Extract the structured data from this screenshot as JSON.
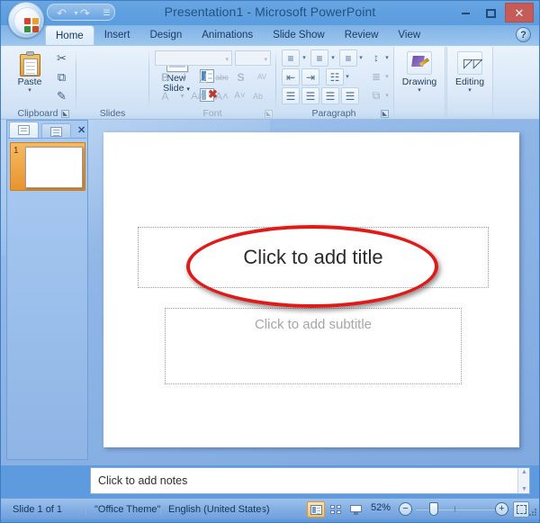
{
  "window": {
    "title": "Presentation1  -  Microsoft PowerPoint",
    "minimize_label": "",
    "maximize_label": "",
    "close_label": "✕"
  },
  "quick_access": {
    "undo_icon": "undo-icon",
    "undo_glyph": "↶",
    "undo_dropdown_glyph": "▾",
    "redo_icon": "redo-icon",
    "redo_glyph": "↷",
    "customize_glyph": "☰"
  },
  "office_button": {
    "label": "Office Button"
  },
  "help": {
    "glyph": "?"
  },
  "tabs": [
    {
      "label": "Home",
      "active": true
    },
    {
      "label": "Insert",
      "active": false
    },
    {
      "label": "Design",
      "active": false
    },
    {
      "label": "Animations",
      "active": false
    },
    {
      "label": "Slide Show",
      "active": false
    },
    {
      "label": "Review",
      "active": false
    },
    {
      "label": "View",
      "active": false
    }
  ],
  "ribbon": {
    "groups": [
      {
        "name": "Clipboard",
        "label": "Clipboard",
        "has_launcher": true,
        "disabled": false
      },
      {
        "name": "Slides",
        "label": "Slides",
        "has_launcher": false,
        "disabled": false
      },
      {
        "name": "Font",
        "label": "Font",
        "has_launcher": true,
        "disabled": true
      },
      {
        "name": "Paragraph",
        "label": "Paragraph",
        "has_launcher": true,
        "disabled": false
      }
    ],
    "clipboard": {
      "paste_label": "Paste",
      "paste_arrow": "▾",
      "cut_glyph": "✂",
      "copy_glyph": "⧉",
      "format_painter_glyph": "✎"
    },
    "slides": {
      "new_slide_line1": "New",
      "new_slide_line2": "Slide",
      "new_slide_arrow": "▾",
      "layout_arrow": "▾",
      "reset_arrow": "▾",
      "delete_glyph": "✖"
    },
    "font": {
      "font_name_value": "",
      "font_size_value": "",
      "bold": "B",
      "italic": "I",
      "underline": "U",
      "strikethrough": "abc",
      "shadow": "S",
      "spacing": "AV",
      "font_color": "A",
      "change_case": "Aa",
      "grow_font": "A˄",
      "shrink_font": "A˅",
      "clear_formatting": "Ab"
    },
    "paragraph": {
      "bullets": "≡",
      "numbering": "≡",
      "line_spacing": "≡",
      "text_direction": "↕",
      "decrease_indent": "⇤",
      "increase_indent": "⇥",
      "columns": "☷",
      "align_text": "≣",
      "align_left": "☰",
      "center": "☰",
      "align_right": "☰",
      "justify": "☰",
      "smartart": "⧉"
    },
    "drawing": {
      "label": "Drawing",
      "arrow": "▾"
    },
    "editing": {
      "label": "Editing",
      "arrow": "▾"
    }
  },
  "slide_pane": {
    "tab_slides_icon": "slides-tab-icon",
    "tab_outline_icon": "outline-tab-icon",
    "close_glyph": "✕",
    "thumbnails": [
      {
        "number": "1"
      }
    ]
  },
  "slide": {
    "title_placeholder": "Click to add title",
    "subtitle_placeholder": "Click to add subtitle",
    "annotation": {
      "shape": "ellipse",
      "color": "#e01b17"
    }
  },
  "notes": {
    "placeholder": "Click to add notes",
    "scroll_up_glyph": "▲",
    "scroll_down_glyph": "▼"
  },
  "status_bar": {
    "slide_count": "Slide 1 of 1",
    "theme": "\"Office Theme\"",
    "language": "English (United States)",
    "views": [
      {
        "name": "normal",
        "label": "Normal",
        "selected": true
      },
      {
        "name": "slide-sorter",
        "label": "Slide Sorter",
        "selected": false
      },
      {
        "name": "slide-show",
        "label": "Slide Show",
        "selected": false
      }
    ],
    "zoom_percent": "52%",
    "zoom_out_glyph": "−",
    "zoom_in_glyph": "+",
    "fit_label": "Fit slide to current window"
  },
  "colors": {
    "accent_blue": "#5b9cdf",
    "ribbon_bg": "#dfebf9",
    "annotation_red": "#e01b17",
    "thumb_orange": "#e8942f",
    "close_red": "#c75b58"
  }
}
